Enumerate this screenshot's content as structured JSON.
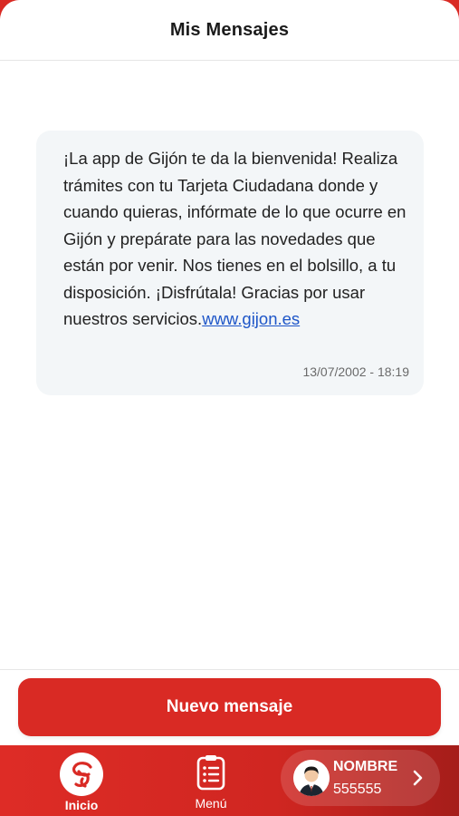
{
  "header": {
    "title": "Mis Mensajes"
  },
  "message": {
    "text": "¡La app de Gijón te da la bienvenida! Realiza trámites con tu Tarjeta Ciudadana donde y cuando quieras, infórmate de lo que ocurre en Gijón y prepárate para las novedades que están por venir. Nos tienes en el bolsillo, a tu disposición. ¡Disfrútala! Gracias por usar nuestros servicios.",
    "link": "www.gijon.es",
    "timestamp": "13/07/2002 - 18:19"
  },
  "actions": {
    "new_message_label": "Nuevo mensaje"
  },
  "tabbar": {
    "home_label": "Inicio",
    "menu_label": "Menú",
    "profile": {
      "name": "NOMBRE",
      "id": "555555"
    }
  },
  "colors": {
    "brand_red": "#d92a24",
    "link_blue": "#1e56c8",
    "card_bg": "#f3f6f8"
  },
  "icons": {
    "home": "gijon-logo-icon",
    "menu": "clipboard-list-icon",
    "avatar": "user-avatar-icon",
    "chevron": "chevron-right-icon"
  }
}
